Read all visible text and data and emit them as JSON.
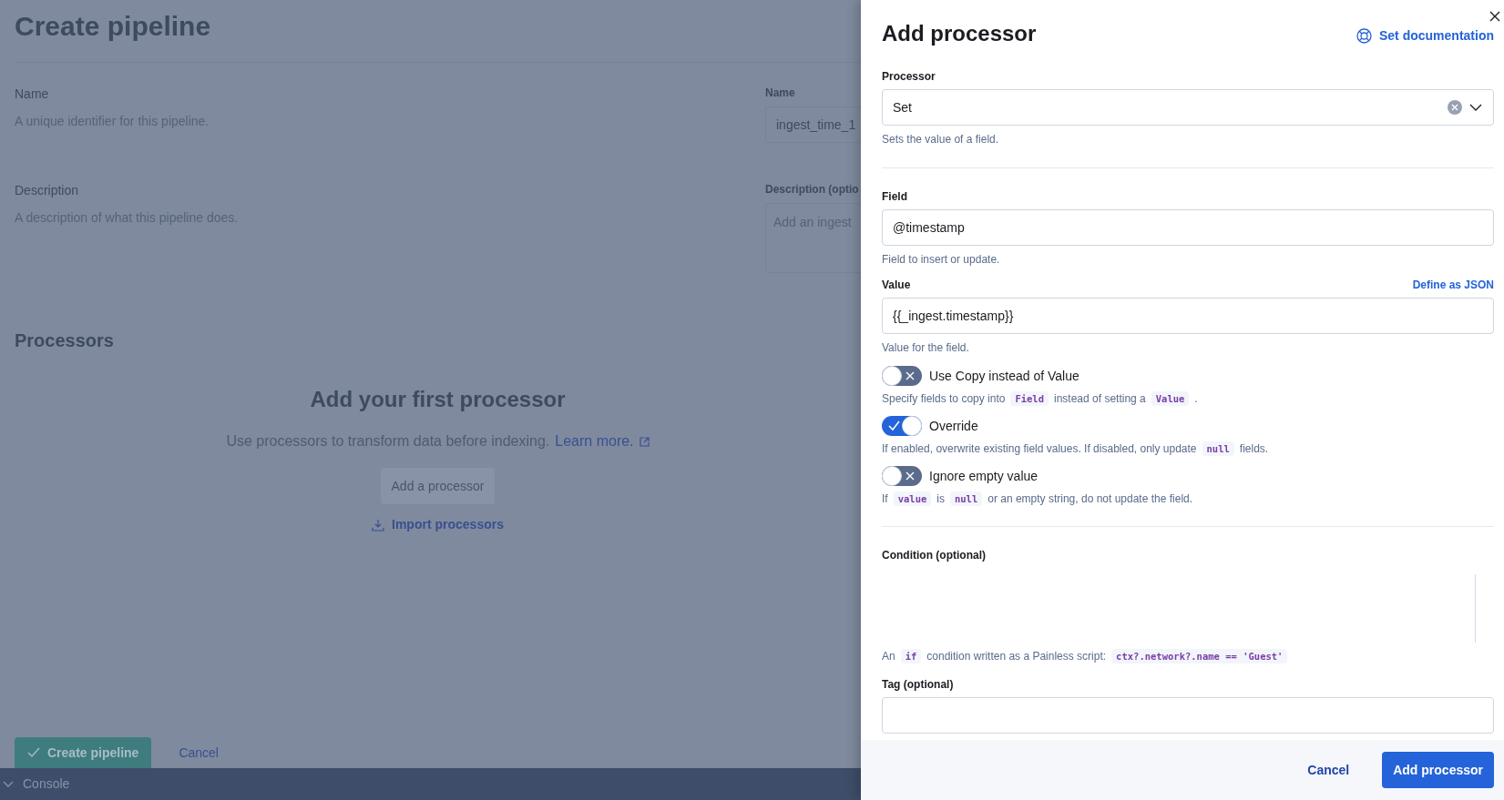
{
  "page": {
    "title": "Create pipeline",
    "sections": [
      {
        "kind": "input",
        "title": "Name",
        "description": "A unique identifier for this pipeline.",
        "field_label": "Name",
        "value": "ingest_time_1"
      },
      {
        "kind": "textarea",
        "title": "Description",
        "description": "A description of what this pipeline does.",
        "field_label": "Description (optio",
        "placeholder": "Add an ingest"
      }
    ],
    "processors": {
      "title": "Processors",
      "empty_title": "Add your first processor",
      "empty_text": "Use processors to transform data before indexing.",
      "learn_more": "Learn more.",
      "add_button": {
        "label": "Add a processor",
        "disabled": true
      },
      "import_link": "Import processors"
    },
    "actions": {
      "create": "Create pipeline",
      "cancel": "Cancel"
    }
  },
  "console": {
    "label": "Console"
  },
  "flyout": {
    "title": "Add processor",
    "doc_link": "Set documentation",
    "processor": {
      "label": "Processor",
      "value": "Set",
      "help": "Sets the value of a field."
    },
    "field": {
      "label": "Field",
      "value": "@timestamp",
      "help": "Field to insert or update."
    },
    "value": {
      "label": "Value",
      "link": "Define as JSON",
      "value": "{{_ingest.timestamp}}",
      "help": "Value for the field."
    },
    "toggles": [
      {
        "label": "Use Copy instead of Value",
        "on": false,
        "help": [
          {
            "text": "Specify fields to copy into"
          },
          {
            "code": "Field"
          },
          {
            "text": "instead of setting a"
          },
          {
            "code": "Value"
          },
          {
            "text": "."
          }
        ]
      },
      {
        "label": "Override",
        "on": true,
        "help": [
          {
            "text": "If enabled, overwrite existing field values. If disabled, only update"
          },
          {
            "code": "null"
          },
          {
            "text": "fields."
          }
        ]
      },
      {
        "label": "Ignore empty value",
        "on": false,
        "help": [
          {
            "text": "If"
          },
          {
            "code": "value"
          },
          {
            "text": "is"
          },
          {
            "code": "null"
          },
          {
            "text": "or an empty string, do not update the field."
          }
        ]
      }
    ],
    "condition": {
      "label": "Condition (optional)",
      "help": [
        {
          "text": "An"
        },
        {
          "code": "if"
        },
        {
          "text": "condition written as a Painless script:"
        },
        {
          "code": "ctx?.network?.name == 'Guest'"
        }
      ]
    },
    "tag": {
      "label": "Tag (optional)"
    },
    "footer": {
      "cancel": "Cancel",
      "submit": "Add processor"
    }
  }
}
